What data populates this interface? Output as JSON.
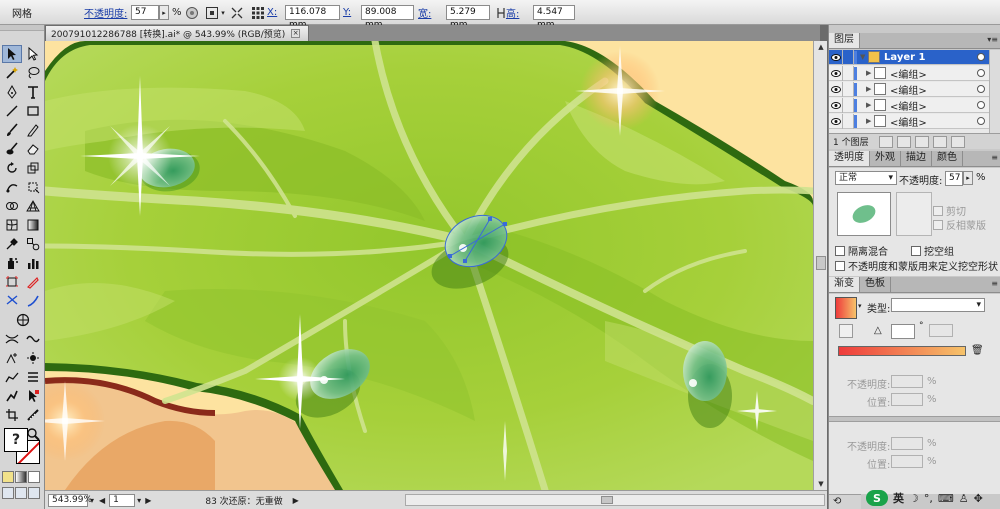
{
  "control_bar": {
    "tool_label": "网格",
    "opacity_label": "不透明度:",
    "opacity_value": "57",
    "percent": "%",
    "x_label": "X:",
    "x_value": "116.078 mm",
    "y_label": "Y:",
    "y_value": "89.008 mm",
    "w_label": "宽:",
    "w_value": "5.279 mm",
    "h_label": "高:",
    "h_value": "4.547 mm"
  },
  "document": {
    "tab_title": "200791012286788 [转换].ai* @ 543.99% (RGB/预览)",
    "close_glyph": "×"
  },
  "status_bar": {
    "zoom": "543.99%",
    "page": "1",
    "history": "83 次还原：无重做"
  },
  "tools": {
    "fill_glyph": "?"
  },
  "layers_panel": {
    "tab": "图层",
    "rows": [
      {
        "name": "Layer 1",
        "selected": true
      },
      {
        "name": "<编组>",
        "selected": false
      },
      {
        "name": "<编组>",
        "selected": false
      },
      {
        "name": "<编组>",
        "selected": false
      },
      {
        "name": "<编组>",
        "selected": false
      }
    ],
    "footer": "1 个图层"
  },
  "transparency_panel": {
    "tabs": [
      "透明度",
      "外观",
      "描边",
      "颜色"
    ],
    "blend_mode": "正常",
    "opacity_label": "不透明度:",
    "opacity_value": "57",
    "percent": "%",
    "clip_label": "剪切",
    "invert_mask_label": "反相蒙版",
    "isolate_label": "隔离混合",
    "knockout_label": "挖空组",
    "opacity_mask_label": "不透明度和蒙版用来定义挖空形状"
  },
  "gradient_panel": {
    "tabs": [
      "渐变",
      "色板"
    ],
    "type_label": "类型:",
    "opacity_label": "不透明度:",
    "position_label": "位置:",
    "percent": "%",
    "colors": {
      "start": "#ee3b3b",
      "end": "#f6c36a"
    }
  },
  "tray": {
    "ime": "S",
    "lang": "英"
  }
}
